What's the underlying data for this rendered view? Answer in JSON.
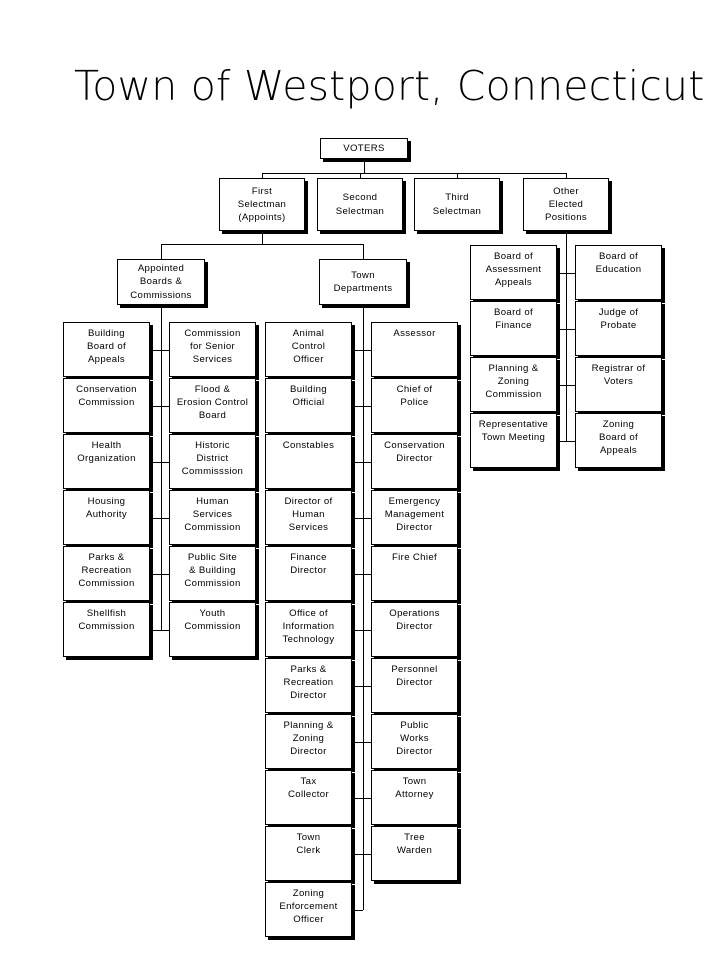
{
  "document": {
    "title": "Town of Westport, Connecticut",
    "type": "organizational-chart",
    "background_color": "#ffffff",
    "line_color": "#000000",
    "box_fill": "#ffffff"
  },
  "chart_data": {
    "type": "diagram",
    "title": "Town of Westport, Connecticut",
    "root": "VOTERS",
    "nodes": {
      "root": {
        "label": "VOTERS",
        "lines": [
          "VOTERS"
        ]
      },
      "level1": [
        {
          "label": "First Selectman (Appoints)",
          "lines": [
            "First",
            "Selectman",
            "(Appoints)"
          ]
        },
        {
          "label": "Second Selectman",
          "lines": [
            "Second",
            "Selectman"
          ]
        },
        {
          "label": "Third Selectman",
          "lines": [
            "Third",
            "Selectman"
          ]
        },
        {
          "label": "Other Elected Positions",
          "lines": [
            "Other",
            "Elected",
            "Positions"
          ]
        }
      ],
      "level2": [
        {
          "label": "Appointed Boards & Commissions",
          "lines": [
            "Appointed",
            "Boards &",
            "Commissions"
          ]
        },
        {
          "label": "Town Departments",
          "lines": [
            "Town",
            "Departments"
          ]
        }
      ]
    },
    "groups": [
      {
        "name": "appointed-boards-and-commissions",
        "parent": "Appointed Boards & Commissions",
        "left_column": [
          {
            "label": "Building Board of Appeals",
            "lines": [
              "Building",
              "Board of",
              "Appeals"
            ]
          },
          {
            "label": "Conservation Commission",
            "lines": [
              "Conservation",
              "Commission"
            ]
          },
          {
            "label": "Health Organization",
            "lines": [
              "Health",
              "Organization"
            ]
          },
          {
            "label": "Housing Authority",
            "lines": [
              "Housing",
              "Authority"
            ]
          },
          {
            "label": "Parks & Recreation Commission",
            "lines": [
              "Parks &",
              "Recreation",
              "Commission"
            ]
          },
          {
            "label": "Shellfish Commission",
            "lines": [
              "Shellfish",
              "Commission"
            ]
          }
        ],
        "right_column": [
          {
            "label": "Commission for Senior Services",
            "lines": [
              "Commission",
              "for Senior",
              "Services"
            ]
          },
          {
            "label": "Flood & Erosion Control Board",
            "lines": [
              "Flood &",
              "Erosion Control",
              "Board"
            ]
          },
          {
            "label": "Historic District Commisssion",
            "lines": [
              "Historic",
              "District",
              "Commisssion"
            ]
          },
          {
            "label": "Human Services Commission",
            "lines": [
              "Human",
              "Services",
              "Commission"
            ]
          },
          {
            "label": "Public Site & Building Commission",
            "lines": [
              "Public Site",
              "& Building",
              "Commission"
            ]
          },
          {
            "label": "Youth Commission",
            "lines": [
              "Youth",
              "Commission"
            ]
          }
        ]
      },
      {
        "name": "town-departments",
        "parent": "Town Departments",
        "left_column": [
          {
            "label": "Animal Control Officer",
            "lines": [
              "Animal",
              "Control",
              "Officer"
            ]
          },
          {
            "label": "Building Official",
            "lines": [
              "Building",
              "Official"
            ]
          },
          {
            "label": "Constables",
            "lines": [
              "Constables"
            ]
          },
          {
            "label": "Director of Human Services",
            "lines": [
              "Director of",
              "Human",
              "Services"
            ]
          },
          {
            "label": "Finance Director",
            "lines": [
              "Finance",
              "Director"
            ]
          },
          {
            "label": "Office of Information Technology",
            "lines": [
              "Office of",
              "Information",
              "Technology"
            ]
          },
          {
            "label": "Parks & Recreation Director",
            "lines": [
              "Parks &",
              "Recreation",
              "Director"
            ]
          },
          {
            "label": "Planning & Zoning Director",
            "lines": [
              "Planning &",
              "Zoning",
              "Director"
            ]
          },
          {
            "label": "Tax Collector",
            "lines": [
              "Tax",
              "Collector"
            ]
          },
          {
            "label": "Town Clerk",
            "lines": [
              "Town",
              "Clerk"
            ]
          },
          {
            "label": "Zoning Enforcement Officer",
            "lines": [
              "Zoning",
              "Enforcement",
              "Officer"
            ]
          }
        ],
        "right_column": [
          {
            "label": "Assessor",
            "lines": [
              "Assessor"
            ]
          },
          {
            "label": "Chief of Police",
            "lines": [
              "Chief of",
              "Police"
            ]
          },
          {
            "label": "Conservation Director",
            "lines": [
              "Conservation",
              "Director"
            ]
          },
          {
            "label": "Emergency Management Director",
            "lines": [
              "Emergency",
              "Management",
              "Director"
            ]
          },
          {
            "label": "Fire Chief",
            "lines": [
              "Fire Chief"
            ]
          },
          {
            "label": "Operations Director",
            "lines": [
              "Operations",
              "Director"
            ]
          },
          {
            "label": "Personnel Director",
            "lines": [
              "Personnel",
              "Director"
            ]
          },
          {
            "label": "Public Works Director",
            "lines": [
              "Public",
              "Works",
              "Director"
            ]
          },
          {
            "label": "Town Attorney",
            "lines": [
              "Town",
              "Attorney"
            ]
          },
          {
            "label": "Tree Warden",
            "lines": [
              "Tree",
              "Warden"
            ]
          }
        ]
      },
      {
        "name": "other-elected-positions",
        "parent": "Other Elected Positions",
        "left_column": [
          {
            "label": "Board of Assessment Appeals",
            "lines": [
              "Board of",
              "Assessment",
              "Appeals"
            ]
          },
          {
            "label": "Board of Finance",
            "lines": [
              "Board of",
              "Finance"
            ]
          },
          {
            "label": "Planning & Zoning Commission",
            "lines": [
              "Planning &",
              "Zoning",
              "Commission"
            ]
          },
          {
            "label": "Representative Town Meeting",
            "lines": [
              "Representative",
              "Town Meeting"
            ]
          }
        ],
        "right_column": [
          {
            "label": "Board of Education",
            "lines": [
              "Board of",
              "Education"
            ]
          },
          {
            "label": "Judge of Probate",
            "lines": [
              "Judge of",
              "Probate"
            ]
          },
          {
            "label": "Registrar of Voters",
            "lines": [
              "Registrar of",
              "Voters"
            ]
          },
          {
            "label": "Zoning Board of Appeals",
            "lines": [
              "Zoning",
              "Board of",
              "Appeals"
            ]
          }
        ]
      }
    ]
  }
}
